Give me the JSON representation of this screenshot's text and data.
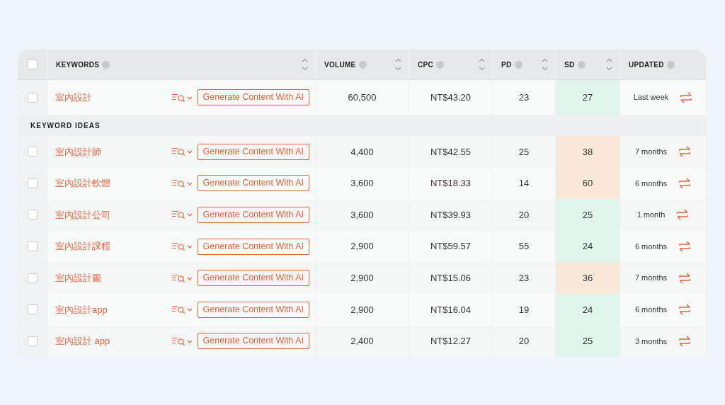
{
  "header": {
    "checked": false,
    "columns": [
      {
        "label": "KEYWORDS",
        "sortable": true
      },
      {
        "label": "VOLUME",
        "sortable": true
      },
      {
        "label": "CPC",
        "sortable": true
      },
      {
        "label": "PD",
        "sortable": true
      },
      {
        "label": "SD",
        "sortable": true
      },
      {
        "label": "UPDATED",
        "sortable": false
      }
    ]
  },
  "main_row": {
    "checked": false,
    "keyword": "室內設計",
    "button": "Generate Content With AI",
    "volume": "60,500",
    "cpc": "NT$43.20",
    "pd": "23",
    "sd": {
      "value": "27",
      "color": "#e0f5ec"
    },
    "updated": "Last week"
  },
  "section_title": "KEYWORD IDEAS",
  "rows": [
    {
      "checked": false,
      "keyword": "室內設計師",
      "button": "Generate Content With AI",
      "volume": "4,400",
      "cpc": "NT$42.55",
      "pd": "25",
      "sd": {
        "value": "38",
        "color": "#f8e9d8"
      },
      "updated": "7 months"
    },
    {
      "checked": false,
      "keyword": "室內設計軟體",
      "button": "Generate Content With AI",
      "volume": "3,600",
      "cpc": "NT$18.33",
      "pd": "14",
      "sd": {
        "value": "60",
        "color": "#f8e9d8"
      },
      "updated": "6 months"
    },
    {
      "checked": false,
      "keyword": "室內設計公司",
      "button": "Generate Content With AI",
      "volume": "3,600",
      "cpc": "NT$39.93",
      "pd": "20",
      "sd": {
        "value": "25",
        "color": "#e0f5ec"
      },
      "updated": "1 month"
    },
    {
      "checked": false,
      "keyword": "室內設計課程",
      "button": "Generate Content With AI",
      "volume": "2,900",
      "cpc": "NT$59.57",
      "pd": "55",
      "sd": {
        "value": "24",
        "color": "#e0f5ec"
      },
      "updated": "6 months"
    },
    {
      "checked": false,
      "keyword": "室內設計圖",
      "button": "Generate Content With AI",
      "volume": "2,900",
      "cpc": "NT$15.06",
      "pd": "23",
      "sd": {
        "value": "36",
        "color": "#f8e9d8"
      },
      "updated": "7 months"
    },
    {
      "checked": false,
      "keyword": "室內設計app",
      "button": "Generate Content With AI",
      "volume": "2,900",
      "cpc": "NT$16.04",
      "pd": "19",
      "sd": {
        "value": "24",
        "color": "#e0f5ec"
      },
      "updated": "6 months"
    },
    {
      "checked": false,
      "keyword": "室內設計 app",
      "button": "Generate Content With AI",
      "volume": "2,400",
      "cpc": "NT$12.27",
      "pd": "20",
      "sd": {
        "value": "25",
        "color": "#e0f5ec"
      },
      "updated": "3 months"
    }
  ]
}
